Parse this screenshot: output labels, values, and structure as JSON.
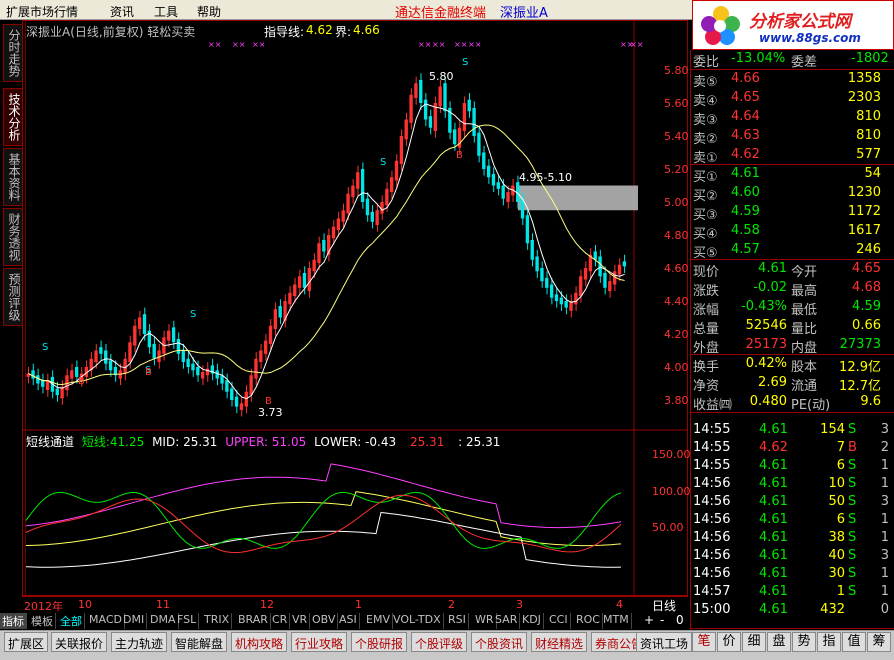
{
  "menu": {
    "items": [
      "扩展市场行情",
      "资讯",
      "工具",
      "帮助"
    ],
    "app_title": "通达信金融终端",
    "stock_title": "深振业A"
  },
  "logo": {
    "text": "分析家公式网",
    "url": "www.88gs.com"
  },
  "left_tabs": [
    "分时走势",
    "技术分析",
    "基本资料",
    "财务透视",
    "预测评级"
  ],
  "chart": {
    "title": "深振业A(日线,前复权) 轻松买卖",
    "indicator_label": "指导线:",
    "indicator_value": "4.62",
    "bound_label": "界:",
    "bound_value": "4.66",
    "price_axis": [
      "5.80",
      "5.60",
      "5.40",
      "5.20",
      "5.00",
      "4.80",
      "4.60",
      "4.40",
      "4.20",
      "4.00",
      "3.80"
    ],
    "high_label": "5.80",
    "low_label": "3.73",
    "zone_label": "4.95-5.10",
    "signal_S": "S",
    "signal_B": "B"
  },
  "lower": {
    "name": "短线通道",
    "line_label": "短线:",
    "line_value": "41.25",
    "mid": "MID: 25.31",
    "upper": "UPPER: 51.05",
    "lower": "LOWER: -0.43",
    "v1": "25.31",
    "v2": ": 25.31",
    "axis": [
      "150.00",
      "100.00",
      "50.00"
    ]
  },
  "period_bar": {
    "labels": [
      "2012年",
      "10",
      "11",
      "12",
      "1",
      "2",
      "3",
      "4"
    ],
    "period": "日线"
  },
  "tabs": [
    "指标",
    "模板",
    "全部",
    "MACD",
    "DMI",
    "DMA",
    "FSL",
    "TRIX",
    "BRAR",
    "CR",
    "VR",
    "OBV",
    "ASI",
    "EMV",
    "VOL-TDX",
    "RSI",
    "WR",
    "SAR",
    "KDJ",
    "CCI",
    "ROC",
    "MTM"
  ],
  "tab_controls": [
    "+",
    "-",
    "0"
  ],
  "bottom_buttons": [
    "扩展区",
    "关联报价",
    "主力轨迹",
    "智能解盘",
    "机构攻略",
    "行业攻略",
    "个股研报",
    "个股评级",
    "个股资讯",
    "财经精选",
    "券商公告",
    "资讯工场"
  ],
  "quote": {
    "header_left": "委比",
    "header_left_val": "-13.04%",
    "header_right": "委差",
    "header_right_val": "-1802",
    "asks": [
      {
        "label": "卖⑤",
        "price": "4.66",
        "vol": "1358"
      },
      {
        "label": "卖④",
        "price": "4.65",
        "vol": "2303"
      },
      {
        "label": "卖③",
        "price": "4.64",
        "vol": "810"
      },
      {
        "label": "卖②",
        "price": "4.63",
        "vol": "810"
      },
      {
        "label": "卖①",
        "price": "4.62",
        "vol": "577"
      }
    ],
    "bids": [
      {
        "label": "买①",
        "price": "4.61",
        "vol": "54"
      },
      {
        "label": "买②",
        "price": "4.60",
        "vol": "1230"
      },
      {
        "label": "买③",
        "price": "4.59",
        "vol": "1172"
      },
      {
        "label": "买④",
        "price": "4.58",
        "vol": "1617"
      },
      {
        "label": "买⑤",
        "price": "4.57",
        "vol": "246"
      }
    ],
    "stats": [
      {
        "l1": "现价",
        "v1": "4.61",
        "c1": "green",
        "l2": "今开",
        "v2": "4.65",
        "c2": "red"
      },
      {
        "l1": "涨跌",
        "v1": "-0.02",
        "c1": "green",
        "l2": "最高",
        "v2": "4.68",
        "c2": "red"
      },
      {
        "l1": "涨幅",
        "v1": "-0.43%",
        "c1": "green",
        "l2": "最低",
        "v2": "4.59",
        "c2": "green"
      },
      {
        "l1": "总量",
        "v1": "52546",
        "c1": "yellow",
        "l2": "量比",
        "v2": "0.66",
        "c2": "yellow"
      },
      {
        "l1": "外盘",
        "v1": "25173",
        "c1": "red",
        "l2": "内盘",
        "v2": "27373",
        "c2": "green"
      }
    ],
    "stats2": [
      {
        "l1": "换手",
        "v1": "0.42%",
        "l2": "股本",
        "v2": "12.9亿"
      },
      {
        "l1": "净资",
        "v1": "2.69",
        "l2": "流通",
        "v2": "12.7亿"
      },
      {
        "l1": "收益㈣",
        "v1": "0.480",
        "l2": "PE(动)",
        "v2": "9.6"
      }
    ],
    "ticks": [
      {
        "t": "14:55",
        "p": "4.61",
        "v": "154",
        "s": "S",
        "n": "3"
      },
      {
        "t": "14:55",
        "p": "4.62",
        "v": "7",
        "s": "B",
        "n": "2"
      },
      {
        "t": "14:55",
        "p": "4.61",
        "v": "6",
        "s": "S",
        "n": "1"
      },
      {
        "t": "14:56",
        "p": "4.61",
        "v": "10",
        "s": "S",
        "n": "1"
      },
      {
        "t": "14:56",
        "p": "4.61",
        "v": "50",
        "s": "S",
        "n": "3"
      },
      {
        "t": "14:56",
        "p": "4.61",
        "v": "6",
        "s": "S",
        "n": "1"
      },
      {
        "t": "14:56",
        "p": "4.61",
        "v": "38",
        "s": "S",
        "n": "1"
      },
      {
        "t": "14:56",
        "p": "4.61",
        "v": "40",
        "s": "S",
        "n": "3"
      },
      {
        "t": "14:56",
        "p": "4.61",
        "v": "30",
        "s": "S",
        "n": "1"
      },
      {
        "t": "14:57",
        "p": "4.61",
        "v": "1",
        "s": "S",
        "n": "1"
      },
      {
        "t": "15:00",
        "p": "4.61",
        "v": "432",
        "s": "",
        "n": "0"
      }
    ],
    "bottom_tabs": [
      "笔",
      "价",
      "细",
      "盘",
      "势",
      "指",
      "值",
      "筹"
    ]
  },
  "colors": {
    "up": "#ff3232",
    "down": "#00e6e6",
    "ma_white": "#ffffff",
    "ma_yellow": "#ffff80",
    "upper": "#ff40ff",
    "mid": "#ffff60",
    "short": "#ff3030",
    "zone": "#c0c0c0"
  }
}
